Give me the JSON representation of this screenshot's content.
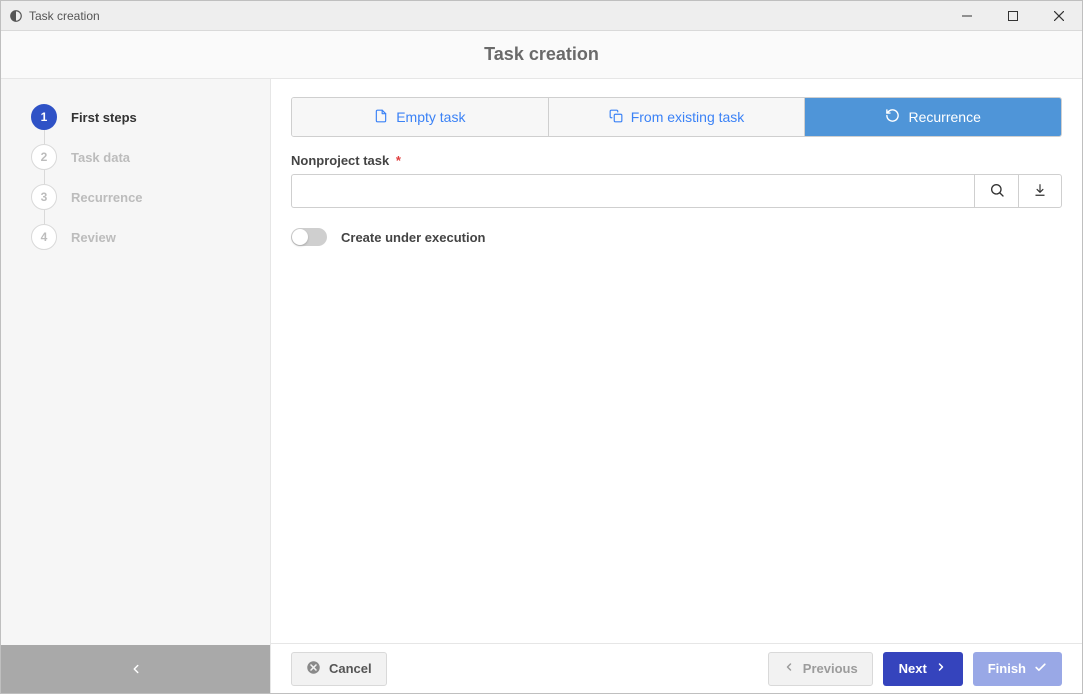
{
  "window": {
    "title": "Task creation"
  },
  "header": {
    "title": "Task creation"
  },
  "sidebar": {
    "steps": [
      {
        "num": "1",
        "label": "First steps",
        "active": true
      },
      {
        "num": "2",
        "label": "Task data",
        "active": false
      },
      {
        "num": "3",
        "label": "Recurrence",
        "active": false
      },
      {
        "num": "4",
        "label": "Review",
        "active": false
      }
    ]
  },
  "tabs": {
    "empty": "Empty task",
    "existing": "From existing task",
    "recurrence": "Recurrence",
    "selected": "recurrence"
  },
  "field": {
    "label": "Nonproject task",
    "required_mark": "*",
    "value": ""
  },
  "toggle": {
    "label": "Create under execution",
    "on": false
  },
  "footer": {
    "cancel": "Cancel",
    "previous": "Previous",
    "next": "Next",
    "finish": "Finish"
  }
}
